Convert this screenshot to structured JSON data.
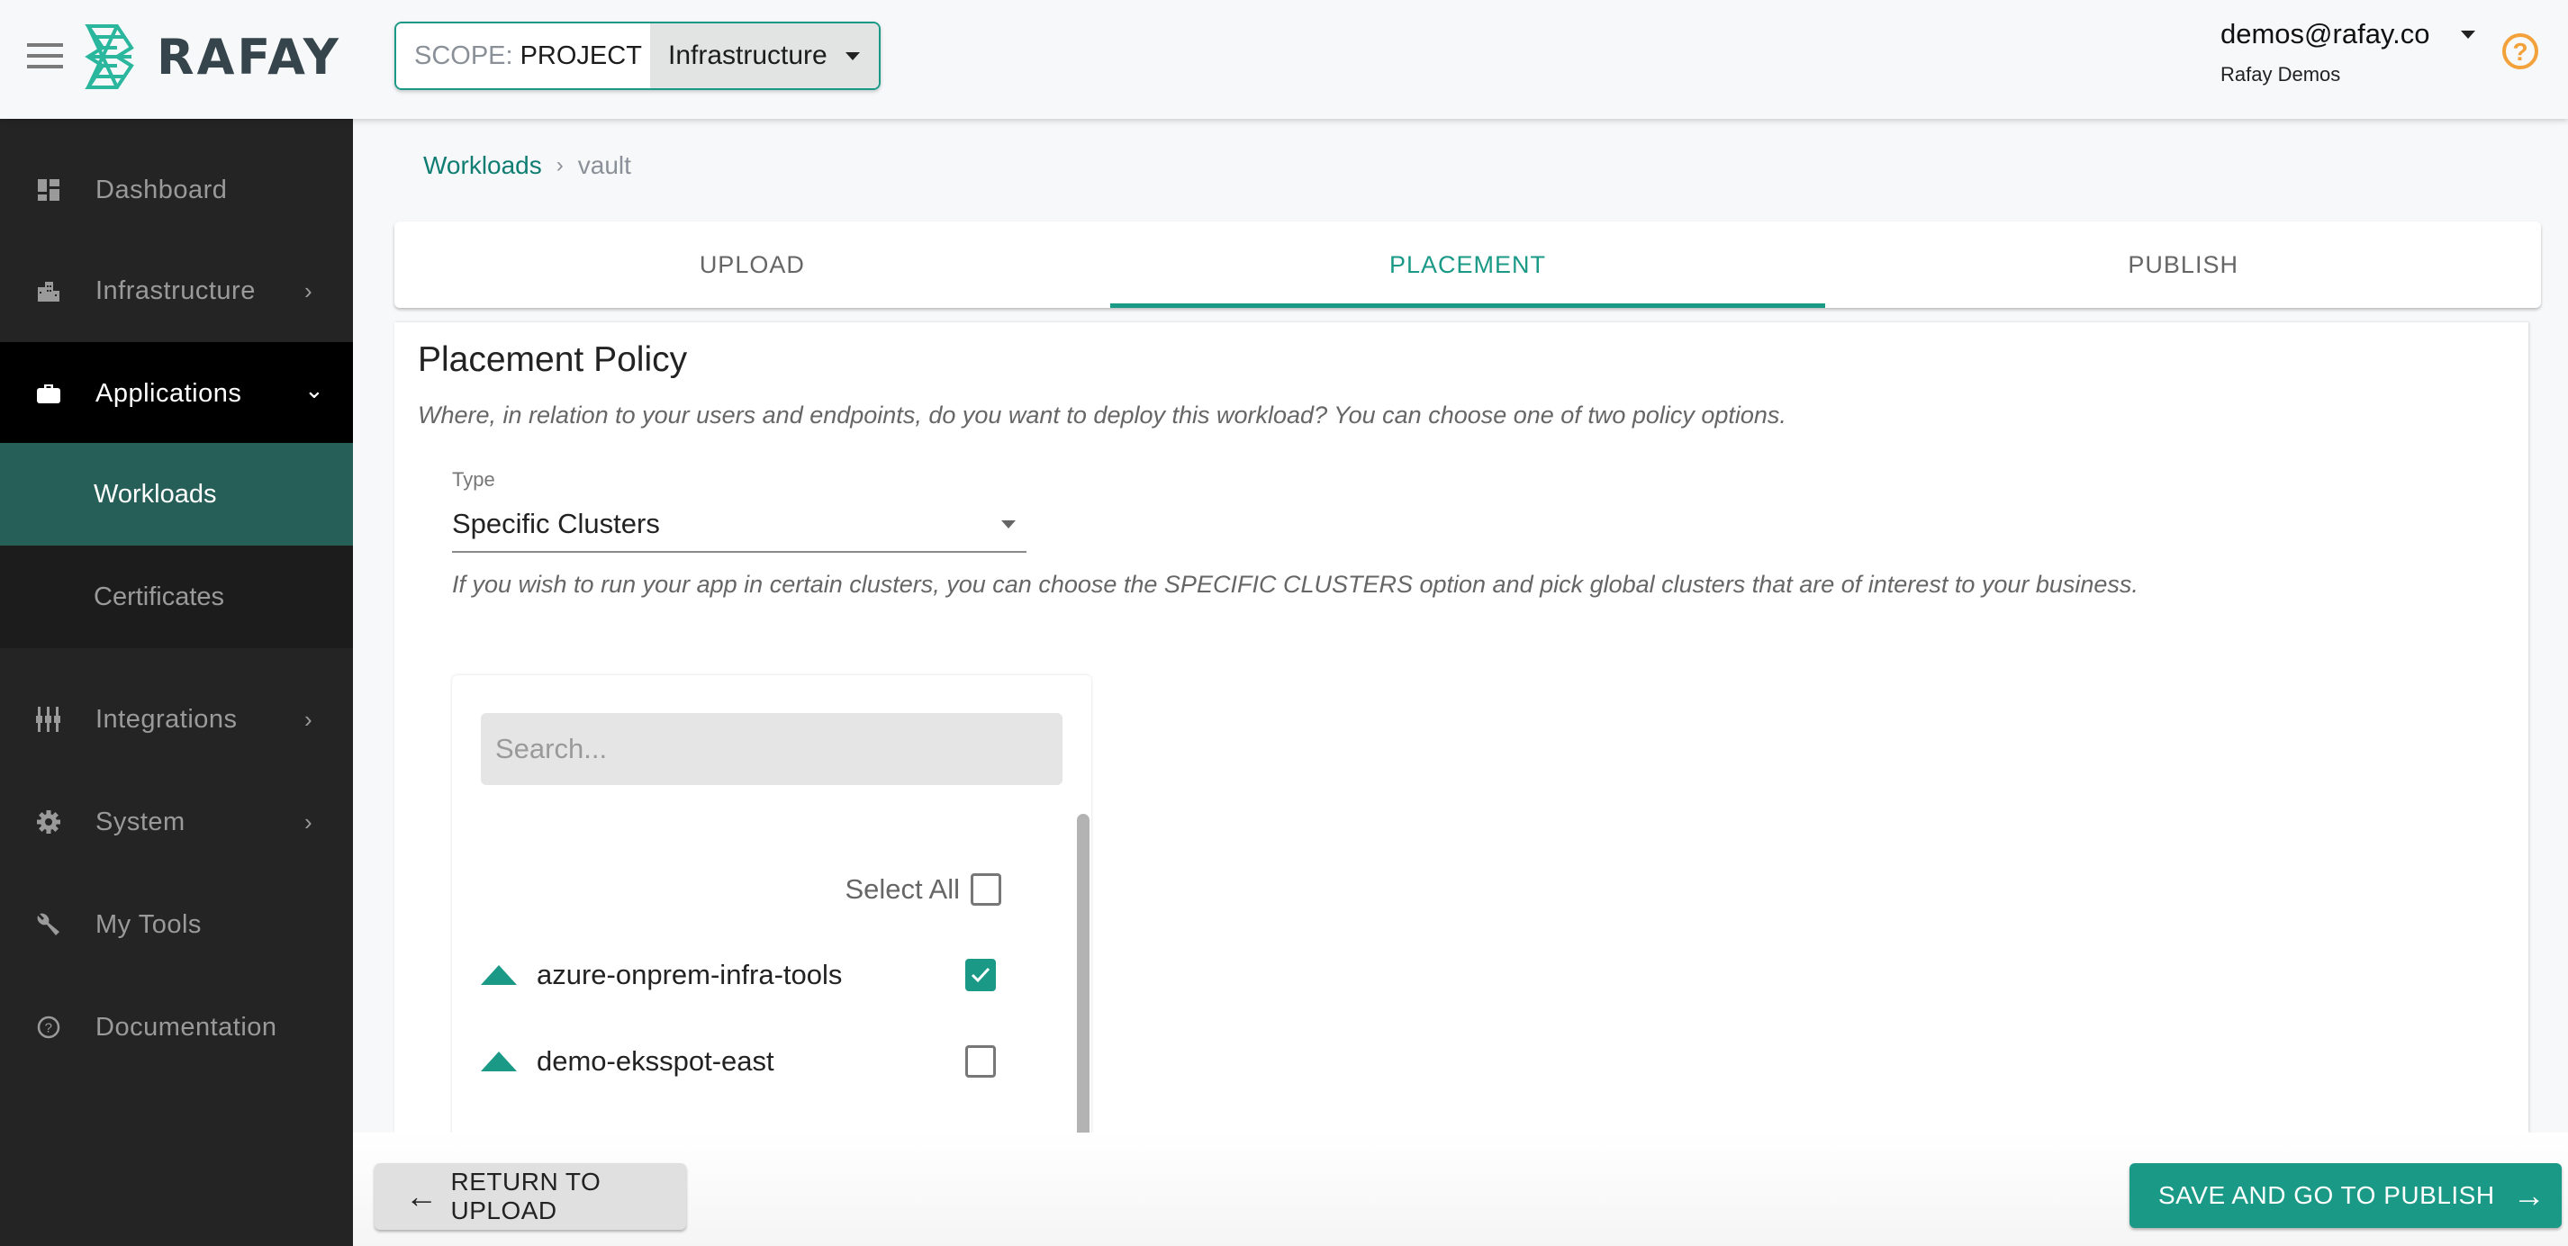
{
  "header": {
    "brand": "RAFAY",
    "scope_label": "SCOPE:",
    "scope_value": "PROJECT",
    "project": "Infrastructure",
    "user_email": "demos@rafay.co",
    "user_org": "Rafay Demos",
    "help_icon": "?"
  },
  "sidebar": {
    "items": [
      {
        "label": "Dashboard",
        "icon": "dashboard-icon"
      },
      {
        "label": "Infrastructure",
        "icon": "building-icon",
        "chevron": "›"
      },
      {
        "label": "Applications",
        "icon": "briefcase-icon",
        "chevron": "⌄"
      },
      {
        "label": "Workloads"
      },
      {
        "label": "Certificates"
      },
      {
        "label": "Integrations",
        "icon": "sliders-icon",
        "chevron": "›"
      },
      {
        "label": "System",
        "icon": "gear-icon",
        "chevron": "›"
      },
      {
        "label": "My Tools",
        "icon": "wrench-icon"
      },
      {
        "label": "Documentation",
        "icon": "help-circle-icon"
      }
    ]
  },
  "breadcrumb": {
    "parent": "Workloads",
    "separator": "›",
    "current": "vault"
  },
  "tabs": [
    {
      "label": "UPLOAD",
      "active": false
    },
    {
      "label": "PLACEMENT",
      "active": true
    },
    {
      "label": "PUBLISH",
      "active": false
    }
  ],
  "placement": {
    "title": "Placement Policy",
    "description": "Where, in relation to your users and endpoints, do you want to deploy this workload? You can choose one of two policy options.",
    "type_label": "Type",
    "type_value": "Specific Clusters",
    "type_hint": "If you wish to run your app in certain clusters, you can choose the SPECIFIC CLUSTERS option and pick global clusters that are of interest to your business.",
    "search_placeholder": "Search...",
    "select_all_label": "Select All",
    "select_all_checked": false,
    "clusters": [
      {
        "name": "azure-onprem-infra-tools",
        "checked": true
      },
      {
        "name": "demo-eksspot-east",
        "checked": false
      }
    ]
  },
  "footer": {
    "back_label": "RETURN TO UPLOAD",
    "next_label": "SAVE AND GO TO PUBLISH"
  },
  "colors": {
    "accent": "#1a9987",
    "sidebar_bg": "#242424",
    "sidebar_selected": "#265e58",
    "help": "#f3a13a"
  }
}
